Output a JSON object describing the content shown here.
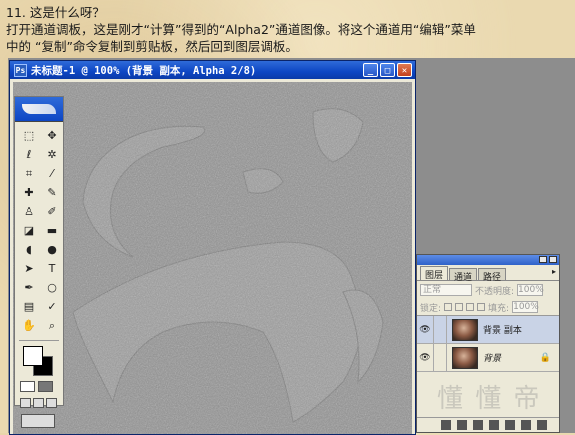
{
  "tutorial": {
    "line1": "11. 这是什么呀？",
    "line2": "打开通道调板，这是刚才“计算”得到的“Alpha2”通道图像。将这个通道用“编辑”菜单",
    "line3": "中的 “复制”命令复制到剪贴板，然后回到图层调板。"
  },
  "document": {
    "title": "未标题-1 @ 100% (背景 副本, Alpha 2/8)",
    "app_icon": "Ps",
    "minimize": "_",
    "maximize": "□",
    "close": "✕"
  },
  "toolbox": {
    "tools": [
      {
        "name": "marquee-tool-icon",
        "glyph": "⬚"
      },
      {
        "name": "move-tool-icon",
        "glyph": "✥"
      },
      {
        "name": "lasso-tool-icon",
        "glyph": "ℓ"
      },
      {
        "name": "magic-wand-tool-icon",
        "glyph": "✲"
      },
      {
        "name": "crop-tool-icon",
        "glyph": "⌗"
      },
      {
        "name": "slice-tool-icon",
        "glyph": "⁄"
      },
      {
        "name": "healing-brush-tool-icon",
        "glyph": "✚"
      },
      {
        "name": "brush-tool-icon",
        "glyph": "✎"
      },
      {
        "name": "clone-stamp-tool-icon",
        "glyph": "♙"
      },
      {
        "name": "history-brush-tool-icon",
        "glyph": "✐"
      },
      {
        "name": "eraser-tool-icon",
        "glyph": "◪"
      },
      {
        "name": "gradient-tool-icon",
        "glyph": "▬"
      },
      {
        "name": "blur-tool-icon",
        "glyph": "◖"
      },
      {
        "name": "dodge-tool-icon",
        "glyph": "●"
      },
      {
        "name": "path-selection-tool-icon",
        "glyph": "➤"
      },
      {
        "name": "type-tool-icon",
        "glyph": "T"
      },
      {
        "name": "pen-tool-icon",
        "glyph": "✒"
      },
      {
        "name": "shape-tool-icon",
        "glyph": "○"
      },
      {
        "name": "notes-tool-icon",
        "glyph": "▤"
      },
      {
        "name": "eyedropper-tool-icon",
        "glyph": "✓"
      },
      {
        "name": "hand-tool-icon",
        "glyph": "✋"
      },
      {
        "name": "zoom-tool-icon",
        "glyph": "⌕"
      }
    ]
  },
  "layers_palette": {
    "tabs": [
      "图层",
      "通道",
      "路径"
    ],
    "menu_arrow": "▸",
    "blend_mode": "正常",
    "opacity_label": "不透明度:",
    "opacity_value": "100%",
    "lock_label": "锁定:",
    "fill_label": "填充:",
    "fill_value": "100%",
    "layers": [
      {
        "name": "背景 副本",
        "visible_icon": "👁",
        "selected": true
      },
      {
        "name": "背景",
        "visible_icon": "👁",
        "selected": false,
        "locked_icon": "🔒"
      }
    ],
    "watermark": "懂 懂 帝"
  }
}
